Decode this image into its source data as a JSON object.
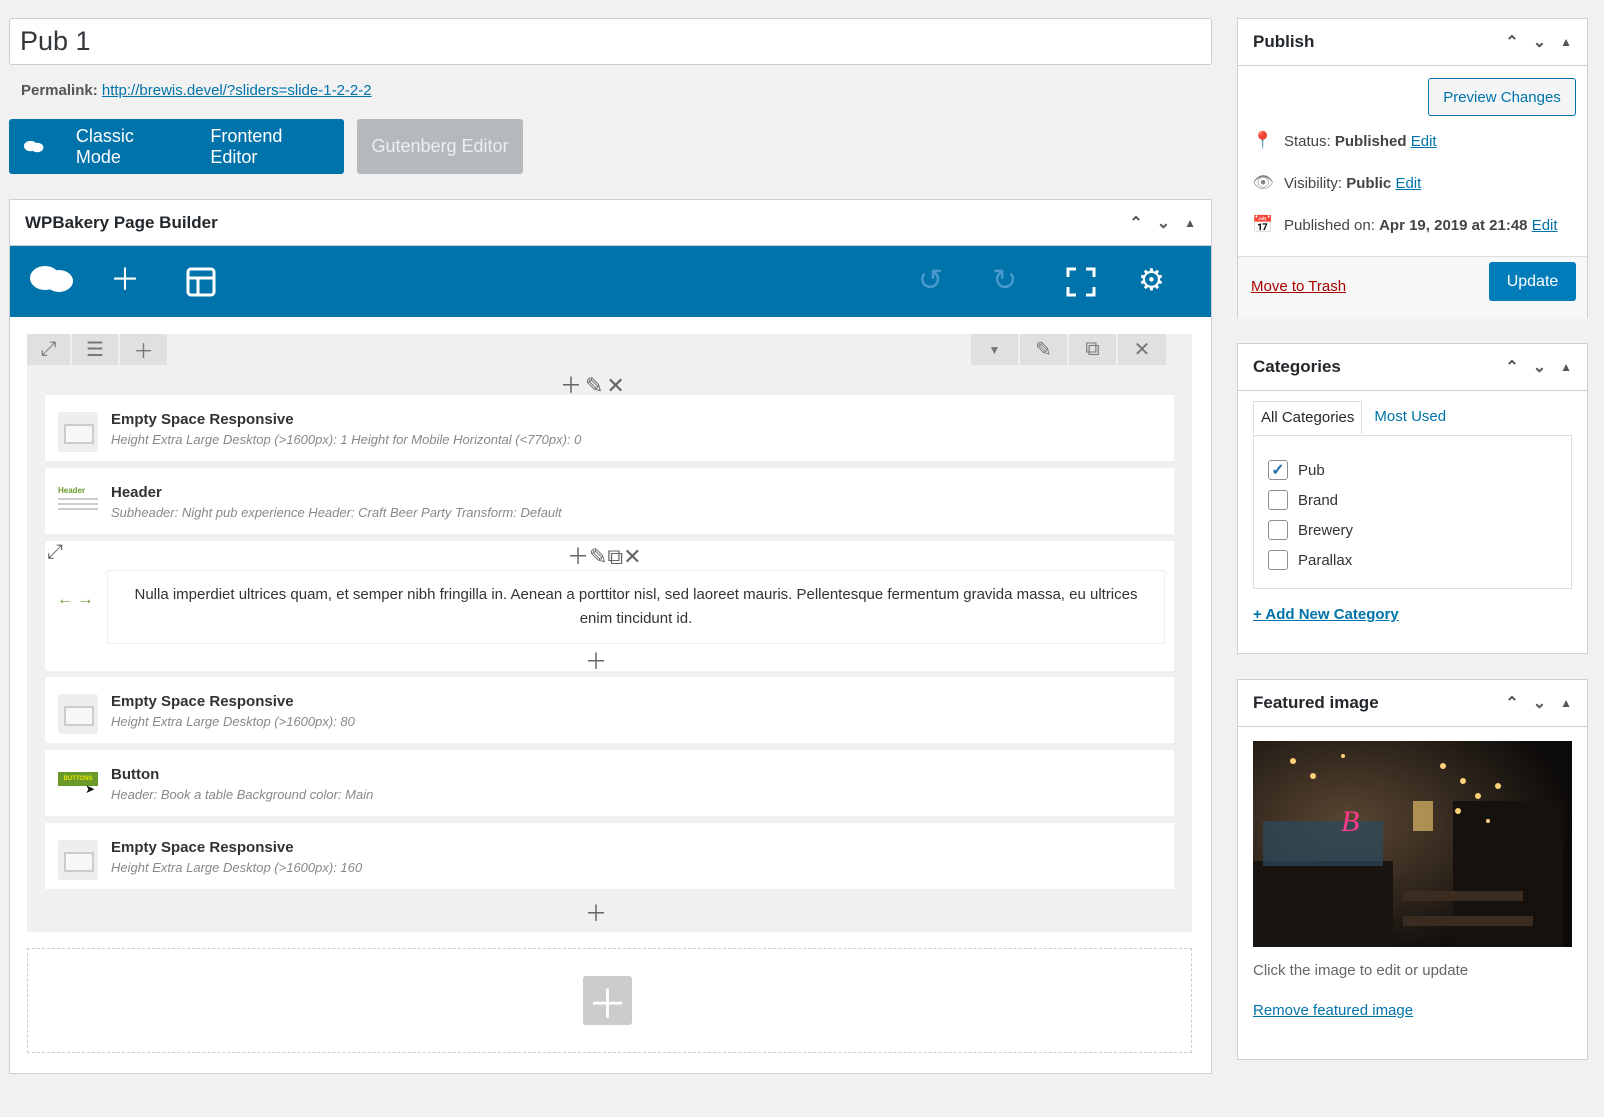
{
  "post": {
    "title": "Pub 1",
    "permalink_label": "Permalink:",
    "permalink_url": "http://brewis.devel/?sliders=slide-1-2-2-2"
  },
  "modes": {
    "classic": "Classic Mode",
    "frontend": "Frontend Editor",
    "gutenberg": "Gutenberg Editor"
  },
  "builder": {
    "title": "WPBakery Page Builder",
    "elements": [
      {
        "title": "Empty Space Responsive",
        "sub": "Height Extra Large Desktop (>1600px): 1  Height for Mobile Horizontal (<770px): 0"
      },
      {
        "title": "Header",
        "sub": "Subheader: Night pub experience  Header: Craft Beer Party  Transform: Default",
        "thumb_label": "Header"
      },
      {
        "title": "Empty Space Responsive",
        "sub": "Height Extra Large Desktop (>1600px): 80"
      },
      {
        "title": "Button",
        "sub": "Header: Book a table  Background color: Main",
        "thumb_label": "BUTTONS"
      },
      {
        "title": "Empty Space Responsive",
        "sub": "Height Extra Large Desktop (>1600px): 160"
      }
    ],
    "text_block": "Nulla imperdiet ultrices quam, et semper nibh fringilla in. Aenean a porttitor nisl, sed laoreet mauris. Pellentesque fermentum gravida massa, eu ultrices enim tincidunt id."
  },
  "publish": {
    "title": "Publish",
    "preview": "Preview Changes",
    "status_label": "Status:",
    "status_value": "Published",
    "visibility_label": "Visibility:",
    "visibility_value": "Public",
    "published_label": "Published on:",
    "published_value": "Apr 19, 2019 at 21:48",
    "edit": "Edit",
    "trash": "Move to Trash",
    "update": "Update"
  },
  "categories": {
    "title": "Categories",
    "tab_all": "All Categories",
    "tab_used": "Most Used",
    "items": [
      {
        "label": "Pub",
        "checked": true
      },
      {
        "label": "Brand",
        "checked": false
      },
      {
        "label": "Brewery",
        "checked": false
      },
      {
        "label": "Parallax",
        "checked": false
      }
    ],
    "add_new": "+ Add New Category"
  },
  "featured": {
    "title": "Featured image",
    "hint": "Click the image to edit or update",
    "remove": "Remove featured image"
  },
  "colors": {
    "accent": "#0073aa",
    "primary_button": "#007cba",
    "trash": "#aa0000"
  }
}
